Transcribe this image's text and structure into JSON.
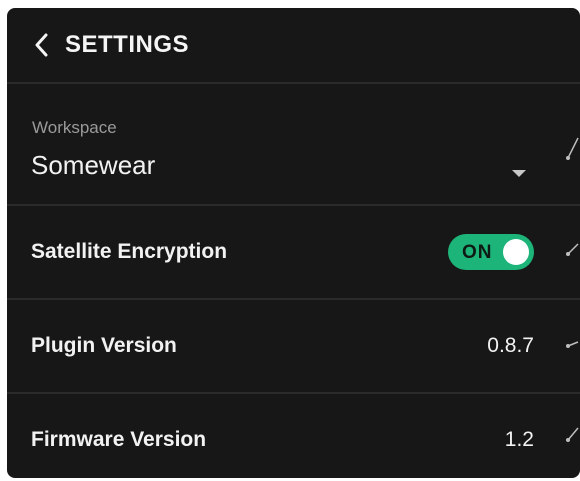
{
  "header": {
    "title": "SETTINGS",
    "back_icon": "chevron-left-icon"
  },
  "workspace": {
    "label": "Workspace",
    "value": "Somewear",
    "dropdown_icon": "caret-down-icon"
  },
  "satellite_encryption": {
    "label": "Satellite Encryption",
    "toggle_label": "ON",
    "enabled": true,
    "toggle_color": "#1db47a"
  },
  "plugin_version": {
    "label": "Plugin Version",
    "value": "0.8.7"
  },
  "firmware_version": {
    "label": "Firmware Version",
    "value": "1.2"
  },
  "colors": {
    "panel_bg": "#171717",
    "divider": "#2b2b2b",
    "accent": "#1db47a"
  }
}
